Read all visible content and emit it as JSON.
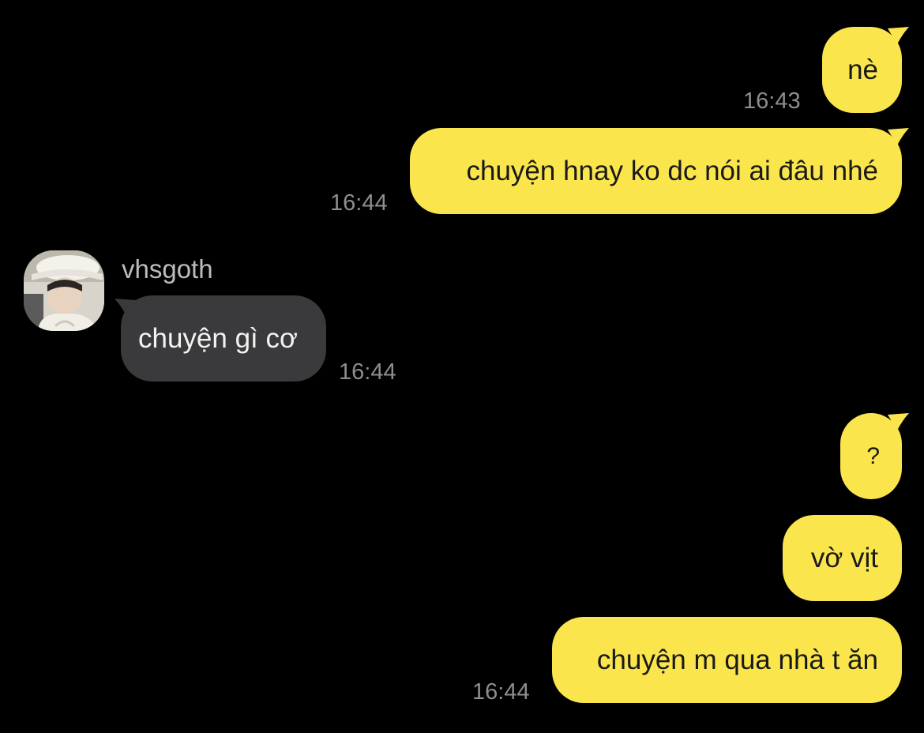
{
  "colors": {
    "background": "#000000",
    "outgoing_bubble": "#FAE64C",
    "incoming_bubble": "#3A3A3C",
    "timestamp": "#8E8E8E",
    "sender_name": "#BDBDBD"
  },
  "messages": [
    {
      "direction": "outgoing",
      "text": "nè",
      "time": "16:43"
    },
    {
      "direction": "outgoing",
      "text": "chuyện hnay ko dc nói ai đâu nhé",
      "time": "16:44"
    },
    {
      "direction": "incoming",
      "sender": "vhsgoth",
      "avatar": "profile-photo",
      "text": "chuyện gì cơ",
      "time": "16:44"
    },
    {
      "direction": "outgoing",
      "text": "?",
      "time": ""
    },
    {
      "direction": "outgoing",
      "text": "vờ vịt",
      "time": ""
    },
    {
      "direction": "outgoing",
      "text": "chuyện m qua nhà t ăn",
      "time": "16:44"
    }
  ]
}
